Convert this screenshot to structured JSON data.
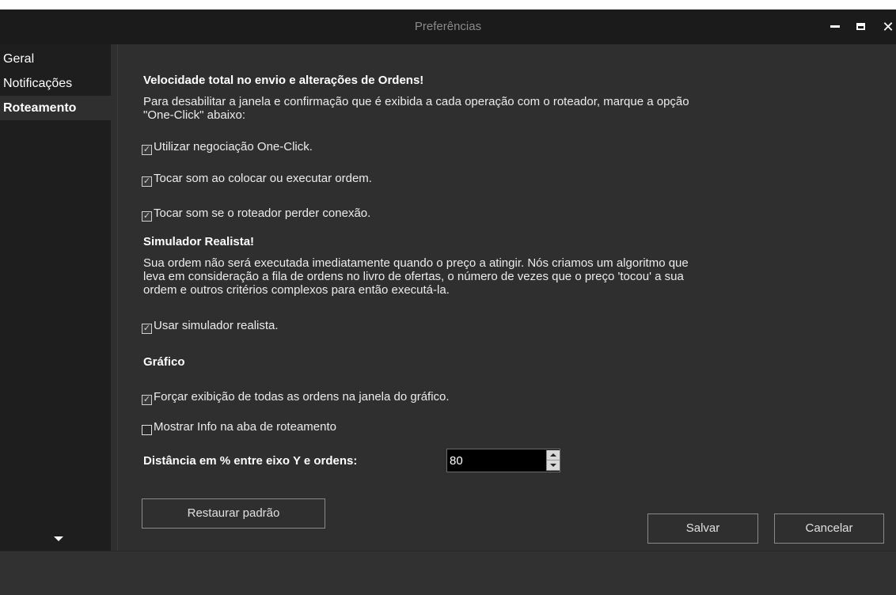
{
  "window": {
    "title": "Preferências",
    "controls": {
      "minimize": "minimize-icon",
      "maximize": "maximize-icon",
      "close": "close-icon"
    }
  },
  "sidebar": {
    "items": [
      {
        "label": "Geral",
        "active": false
      },
      {
        "label": "Notificações",
        "active": false
      },
      {
        "label": "Roteamento",
        "active": true
      }
    ],
    "scroll_icon": "triangle-down-icon"
  },
  "routing": {
    "speed_heading": "Velocidade total no envio e alterações de Ordens!",
    "speed_desc_line1": "Para desabilitar a janela e confirmação que é exibida a cada operação com o roteador, marque a opção",
    "speed_desc_line2": "\"One-Click\" abaixo:",
    "one_click": {
      "label": "Utilizar negociação One-Click.",
      "checked": true
    },
    "sound_order": {
      "label": "Tocar som ao colocar ou executar ordem.",
      "checked": true
    },
    "sound_disconnect": {
      "label": "Tocar som se o roteador perder conexão.",
      "checked": true
    },
    "simulator_heading": "Simulador Realista!",
    "simulator_desc_line1": "Sua ordem não será executada imediatamente quando o preço a atingir.  Nós criamos um algoritmo que",
    "simulator_desc_line2": "leva em consideração a fila de ordens no livro de ofertas, o número de vezes que o preço 'tocou' a sua",
    "simulator_desc_line3": "ordem e outros critérios complexos para então executá-la.",
    "use_simulator": {
      "label": "Usar simulador realista.",
      "checked": true
    },
    "chart_heading": "Gráfico",
    "force_orders": {
      "label": "Forçar exibição de todas as ordens na janela do gráfico.",
      "checked": true
    },
    "show_info": {
      "label": "Mostrar Info na aba de roteamento",
      "checked": false
    },
    "distance_label": "Distância em % entre eixo Y e ordens:",
    "distance_value": "80"
  },
  "buttons": {
    "restore": "Restaurar padrão",
    "save": "Salvar",
    "cancel": "Cancelar"
  },
  "colors": {
    "background": "#2f2f2f",
    "titlebar": "#1b1b1b",
    "sidebar": "#1e1e1e",
    "input_bg": "#000000"
  }
}
